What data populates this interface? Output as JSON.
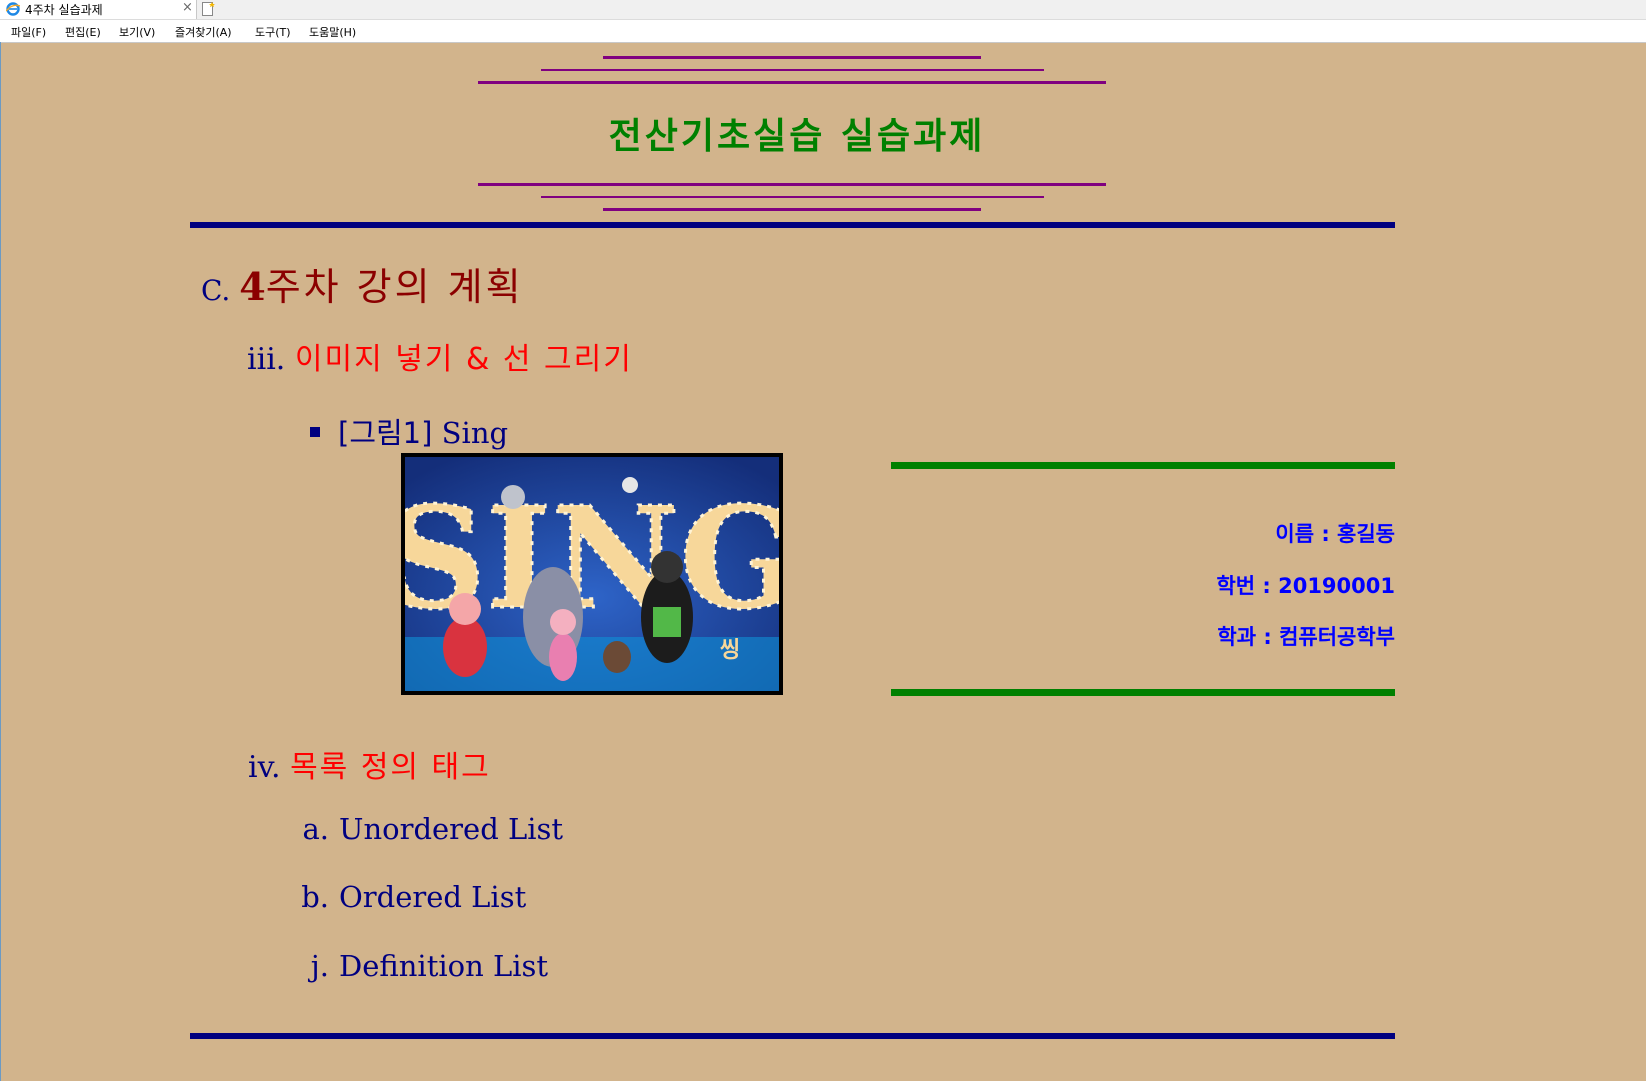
{
  "browser": {
    "tab_title": "4주차 실습과제",
    "tab_close": "×",
    "menu": [
      "파일(F)",
      "편집(E)",
      "보기(V)",
      "즐겨찾기(A)",
      "도구(T)",
      "도움말(H)"
    ]
  },
  "page": {
    "title": "전산기초실습 실습과제",
    "section": {
      "marker": "C.",
      "num": "4",
      "text": "주차 강의 계획"
    },
    "sub1": {
      "marker": "iii.",
      "text": "이미지 넣기 & 선 그리기"
    },
    "figure": {
      "prefix": "[그림1]",
      "caption": "Sing"
    },
    "info": {
      "name": "이름 : 홍길동",
      "student_id": "학번 : 20190001",
      "dept": "학과 : 컴퓨터공학부"
    },
    "sub2": {
      "marker": "iv.",
      "text": "목록 정의 태그"
    },
    "list": [
      {
        "label": "a.",
        "text": "Unordered List"
      },
      {
        "label": "b.",
        "text": "Ordered List"
      },
      {
        "label": "j.",
        "text": "Definition List"
      }
    ],
    "image_text": "SING",
    "image_badge": "씽"
  },
  "colors": {
    "background": "#d2b48c",
    "title": "#008000",
    "purple_lines": "#800080",
    "navy_lines": "#000080",
    "green_lines": "#008000",
    "info_text": "#0000ff"
  }
}
